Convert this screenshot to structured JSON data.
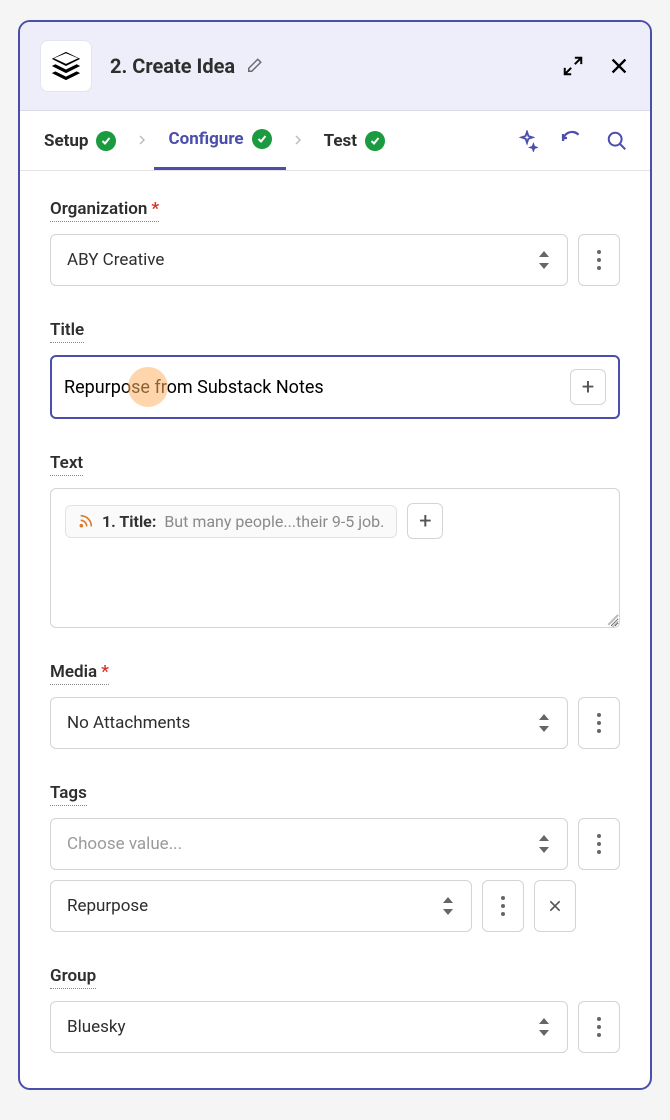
{
  "header": {
    "title": "2. Create Idea"
  },
  "tabs": {
    "setup": "Setup",
    "configure": "Configure",
    "test": "Test"
  },
  "fields": {
    "organization": {
      "label": "Organization",
      "required": true,
      "value": "ABY Creative"
    },
    "title": {
      "label": "Title",
      "value": "Repurpose from Substack Notes"
    },
    "text": {
      "label": "Text",
      "chip_step": "1. Title:",
      "chip_text": "But many people...their 9-5 job."
    },
    "media": {
      "label": "Media",
      "required": true,
      "value": "No Attachments"
    },
    "tags": {
      "label": "Tags",
      "placeholder": "Choose value...",
      "selected": "Repurpose"
    },
    "group": {
      "label": "Group",
      "value": "Bluesky"
    }
  }
}
